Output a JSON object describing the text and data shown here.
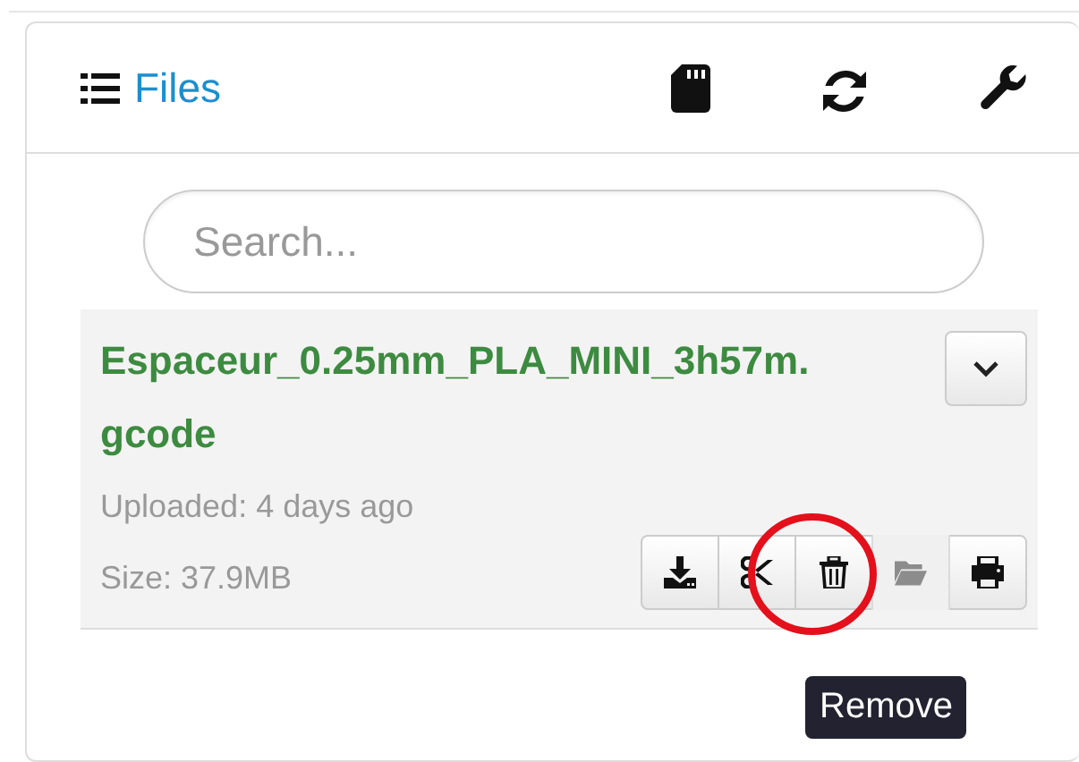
{
  "panel": {
    "title": "Files"
  },
  "search": {
    "placeholder": "Search..."
  },
  "files": [
    {
      "name": "Espaceur_0.25mm_PLA_MINI_3h57m.gcode",
      "uploaded": "Uploaded: 4 days ago",
      "size": "Size: 37.9MB",
      "actions": [
        {
          "kind": "download",
          "disabled": false
        },
        {
          "kind": "cut",
          "disabled": false
        },
        {
          "kind": "remove",
          "disabled": false
        },
        {
          "kind": "folder",
          "disabled": true
        },
        {
          "kind": "print",
          "disabled": false
        }
      ]
    }
  ],
  "tooltip": {
    "text": "Remove"
  }
}
